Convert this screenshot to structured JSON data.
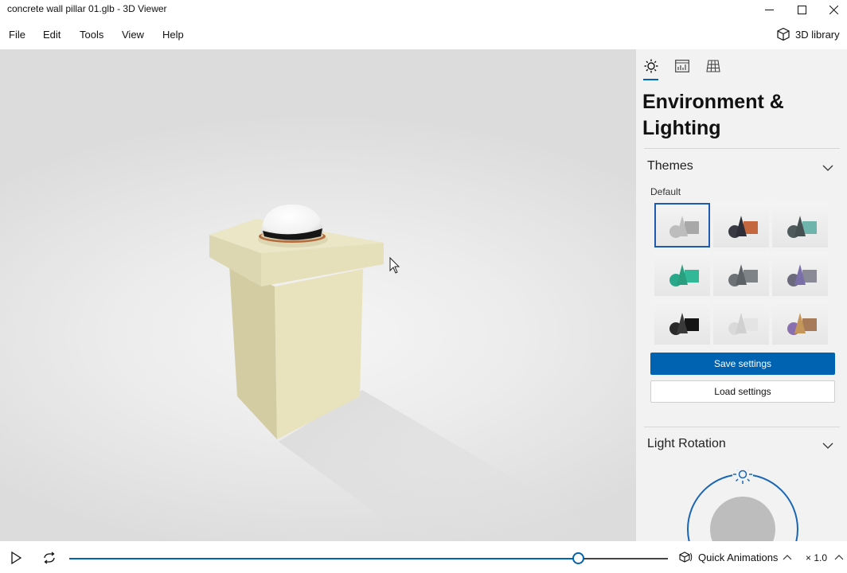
{
  "window": {
    "title": "concrete wall pillar 01.glb - 3D Viewer"
  },
  "menu": {
    "items": [
      "File",
      "Edit",
      "Tools",
      "View",
      "Help"
    ],
    "library_label": "3D library"
  },
  "panel": {
    "tabs": [
      "environment-tab",
      "stats-tab",
      "grid-tab"
    ],
    "active_tab": "environment-tab",
    "title": "Environment & Lighting",
    "themes_heading": "Themes",
    "theme_selected_label": "Default",
    "themes": [
      {
        "id": "default",
        "sphere": "#bdbdbd",
        "cone": "#bdbdbd",
        "box": "#a8a8a8"
      },
      {
        "id": "warm",
        "sphere": "#3a3a44",
        "cone": "#2e2e38",
        "box": "#c4673f"
      },
      {
        "id": "teal",
        "sphere": "#4e5a5c",
        "cone": "#465052",
        "box": "#6fb3ad"
      },
      {
        "id": "green",
        "sphere": "#2aa88a",
        "cone": "#2a9f80",
        "box": "#31b896"
      },
      {
        "id": "grey",
        "sphere": "#6c7275",
        "cone": "#5d6366",
        "box": "#7d8386"
      },
      {
        "id": "violet",
        "sphere": "#6a6a7c",
        "cone": "#7a6fa8",
        "box": "#8a8a96"
      },
      {
        "id": "black",
        "sphere": "#2a2a2a",
        "cone": "#3a3a3a",
        "box": "#151515"
      },
      {
        "id": "white",
        "sphere": "#d9d9d9",
        "cone": "#d0d0d0",
        "box": "#e4e4e4"
      },
      {
        "id": "sunset",
        "sphere": "#8a6fb0",
        "cone": "#c4965a",
        "box": "#a77b5a"
      }
    ],
    "save_label": "Save settings",
    "load_label": "Load settings",
    "light_rotation_heading": "Light Rotation"
  },
  "bottombar": {
    "quick_animations_label": "Quick Animations",
    "speed_label": "× 1.0",
    "progress": 0.85
  },
  "colors": {
    "accent": "#0063b1",
    "pillar": "#e8e2bd",
    "panel_bg": "#f2f2f2"
  }
}
